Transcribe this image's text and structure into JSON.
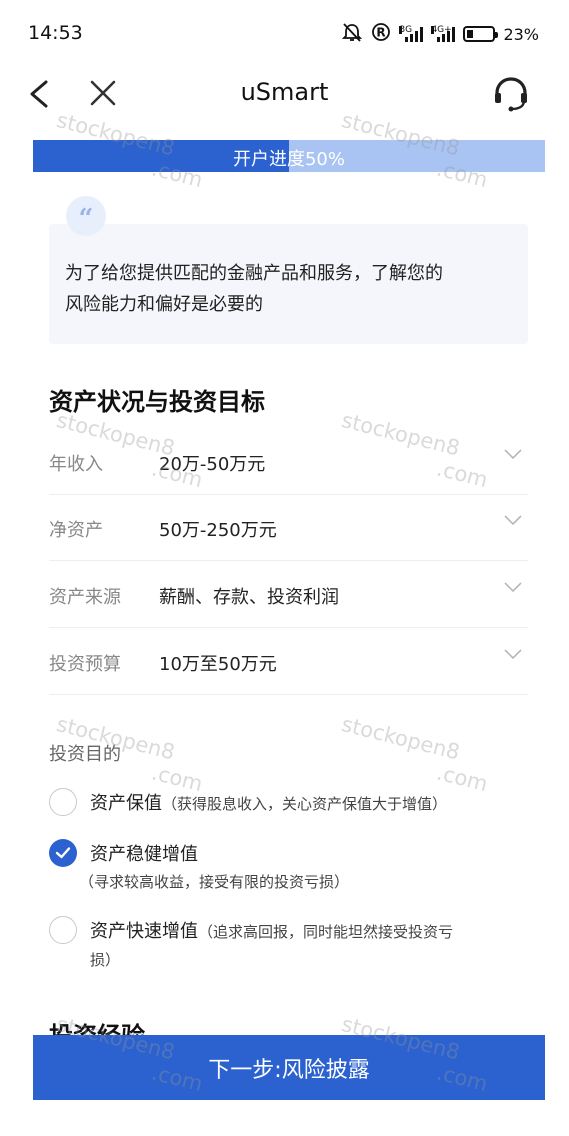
{
  "status_bar": {
    "time": "14:53",
    "net_3g": "3G",
    "net_4g": "4G+",
    "battery": "23%"
  },
  "nav": {
    "title": "uSmart",
    "icons": [
      "back-icon",
      "close-icon",
      "headset-icon"
    ]
  },
  "progress": {
    "label": "开户进度50%",
    "value": 0.5
  },
  "intro": {
    "quote": "“",
    "text_line1": "为了给您提供匹配的金融产品和服务，了解您的",
    "text_line2": "风险能力和偏好是必要的"
  },
  "section": {
    "title": "资产状况与投资目标"
  },
  "fields": [
    {
      "label": "年收入",
      "value": "20万-50万元"
    },
    {
      "label": "净资产",
      "value": "50万-250万元"
    },
    {
      "label": "资产来源",
      "value": "薪酬、存款、投资利润"
    },
    {
      "label": "投资预算",
      "value": "10万至50万元"
    }
  ],
  "purpose": {
    "title": "投资目的",
    "options": [
      {
        "label": "资产保值",
        "desc": "（获得股息收入，关心资产保值大于增值）",
        "checked": false
      },
      {
        "label": "资产稳健增值",
        "desc": "（寻求较高收益，接受有限的投资亏损）",
        "checked": true
      },
      {
        "label": "资产快速增值",
        "desc": "（追求高回报，同时能坦然接受投资亏",
        "desc2": "损）",
        "checked": false
      }
    ]
  },
  "next_section_title": "投资经验",
  "next_button": "下一步:风险披露",
  "watermark": {
    "line1": "stockopen8",
    "line2": ".com"
  },
  "colors": {
    "primary": "#2b62d0",
    "progress_track": "#a9c4f3"
  }
}
